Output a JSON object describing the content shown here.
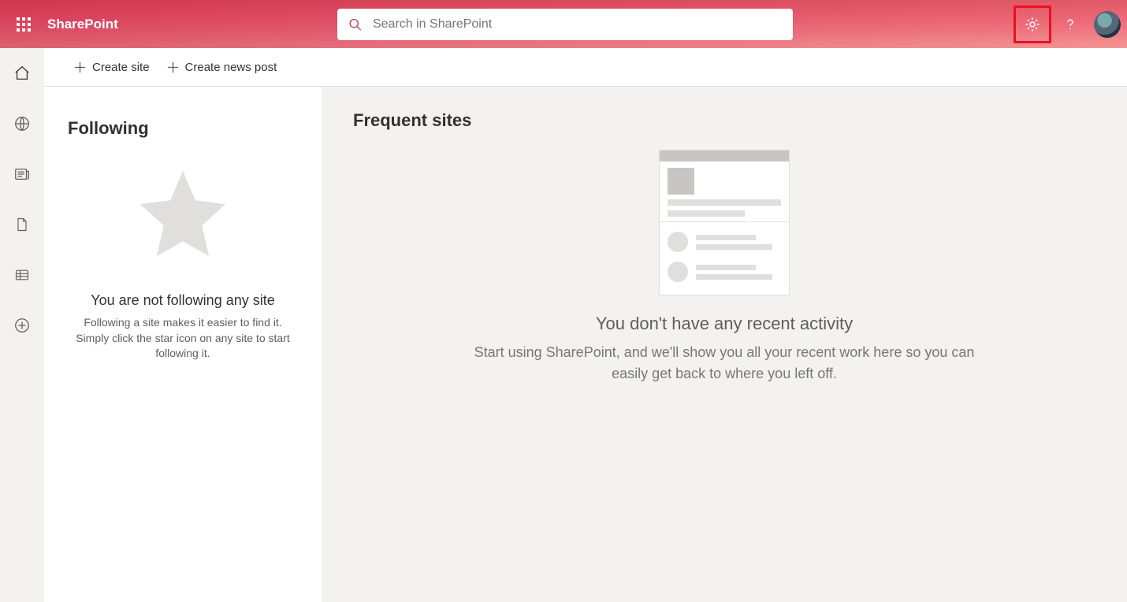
{
  "header": {
    "app_name": "SharePoint",
    "search_placeholder": "Search in SharePoint"
  },
  "commands": {
    "create_site": "Create site",
    "create_news_post": "Create news post"
  },
  "following": {
    "title": "Following",
    "empty_heading": "You are not following any site",
    "empty_body": "Following a site makes it easier to find it. Simply click the star icon on any site to start following it."
  },
  "frequent": {
    "title": "Frequent sites",
    "empty_heading": "You don't have any recent activity",
    "empty_body": "Start using SharePoint, and we'll show you all your recent work here so you can easily get back to where you left off."
  }
}
